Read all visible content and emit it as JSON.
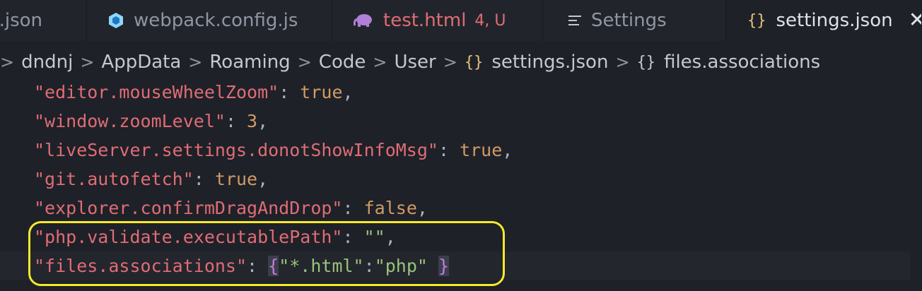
{
  "tabs": [
    {
      "label": "e.json",
      "icon": "json-file-icon"
    },
    {
      "label": "webpack.config.js",
      "icon": "webpack-icon"
    },
    {
      "label": "test.html",
      "badge": "4, U",
      "icon": "php-elephant-icon"
    },
    {
      "label": "Settings",
      "icon": "settings-lines-icon"
    },
    {
      "label": "settings.json",
      "icon": "braces-icon",
      "close": "✕"
    }
  ],
  "breadcrumb": [
    "dndnj",
    "AppData",
    "Roaming",
    "Code",
    "User",
    "settings.json",
    "files.associations"
  ],
  "breadcrumb_sep": ">",
  "code": {
    "line1": {
      "key": "\"editor.mouseWheelZoom\"",
      "value": "true"
    },
    "line2": {
      "key": "\"window.zoomLevel\"",
      "value": "3"
    },
    "line3": {
      "key": "\"liveServer.settings.donotShowInfoMsg\"",
      "value": "true"
    },
    "line4": {
      "key": "\"git.autofetch\"",
      "value": "true"
    },
    "line5": {
      "key": "\"explorer.confirmDragAndDrop\"",
      "value": "false"
    },
    "line6": {
      "key": "\"php.validate.executablePath\"",
      "value": "\"\""
    },
    "line7": {
      "key": "\"files.associations\"",
      "inner_key": "\"*.html\"",
      "inner_value": "\"php\""
    }
  },
  "colors": {
    "highlight": "#f5e92a",
    "key": "#e06c75",
    "string": "#98c379",
    "literal": "#d19a66"
  }
}
